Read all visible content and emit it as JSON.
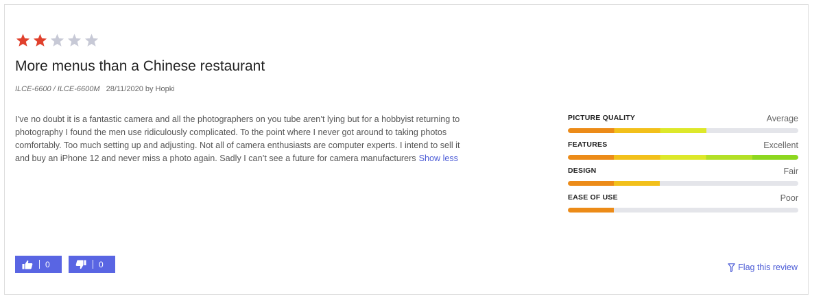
{
  "review": {
    "stars": {
      "rating": 2,
      "max": 5,
      "filled_color": "#e0402c",
      "empty_color": "#c7c9d6"
    },
    "title": "More menus than a Chinese restaurant",
    "model": "ILCE-6600 / ILCE-6600M",
    "date_author": "28/11/2020 by Hopki",
    "body": "I’ve no doubt it is a fantastic camera and all the photographers on you tube aren’t lying but for a hobbyist returning to photography I found the men use ridiculously complicated. To the point where I never got around to taking photos comfortably. Too much setting up and adjusting. Not all of camera enthusiasts are computer experts. I intend to sell it and buy an iPhone 12 and never miss a photo again. Sadly I can’t see a future for camera manufacturers",
    "show_less_label": "Show less"
  },
  "ratings": [
    {
      "label": "PICTURE QUALITY",
      "value_label": "Average",
      "level": 3,
      "max": 5
    },
    {
      "label": "FEATURES",
      "value_label": "Excellent",
      "level": 5,
      "max": 5
    },
    {
      "label": "DESIGN",
      "value_label": "Fair",
      "level": 2,
      "max": 5
    },
    {
      "label": "EASE OF USE",
      "value_label": "Poor",
      "level": 1,
      "max": 5
    }
  ],
  "rating_gradient": [
    "#ec8b18",
    "#f2c01b",
    "#dde82a",
    "#b3e026",
    "#8dd71f"
  ],
  "votes": {
    "helpful": {
      "icon": "thumbs-up-icon",
      "count": "0"
    },
    "unhelpful": {
      "icon": "thumbs-down-icon",
      "count": "0"
    }
  },
  "flag": {
    "icon": "flag-icon",
    "label": "Flag this review"
  },
  "colors": {
    "accent": "#5965e3",
    "link": "#4a5ad6"
  }
}
